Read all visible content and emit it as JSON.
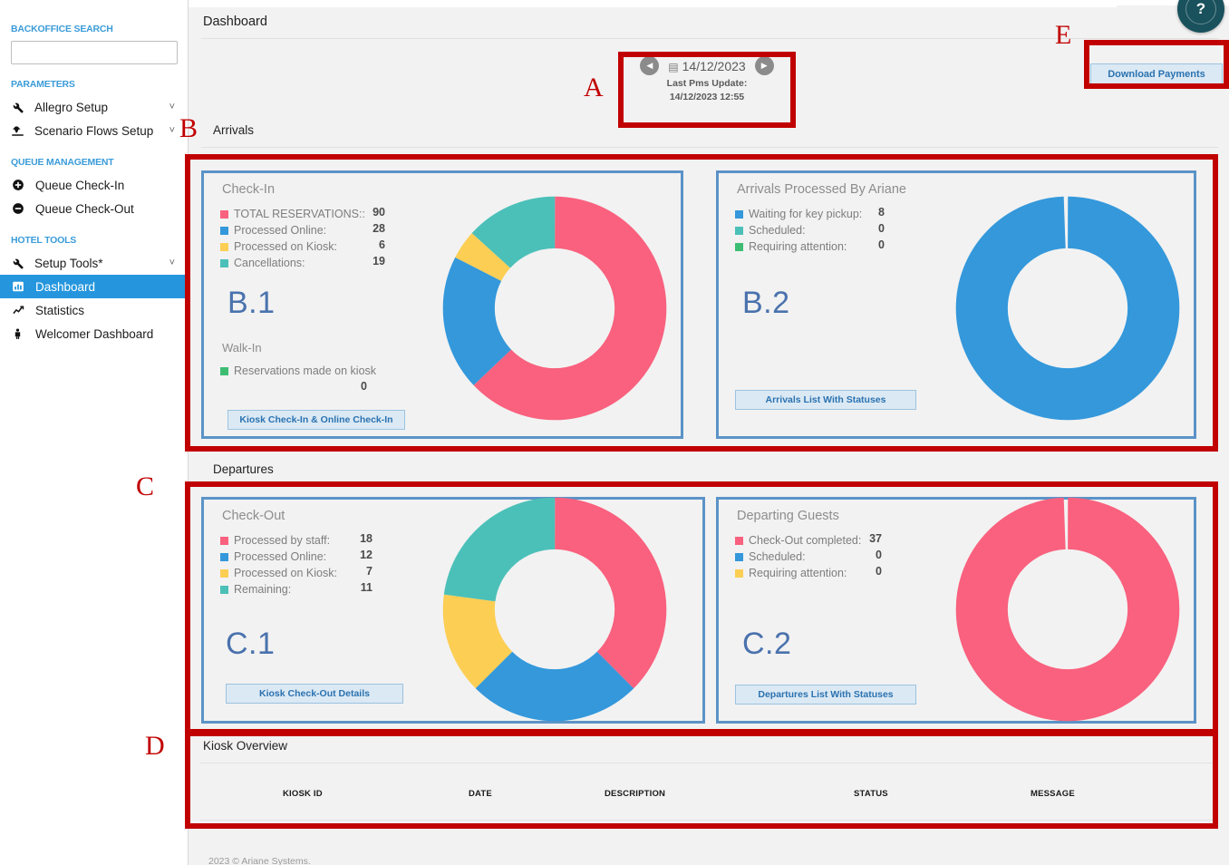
{
  "sidebar": {
    "search": {
      "label": "BACKOFFICE SEARCH",
      "value": "",
      "placeholder": ""
    },
    "groups": [
      {
        "title": "PARAMETERS",
        "items": [
          {
            "label": "Allegro Setup",
            "icon": "wrench-icon",
            "caret": "˅"
          },
          {
            "label": "Scenario Flows Setup",
            "icon": "flow-icon",
            "caret": "˅"
          }
        ]
      },
      {
        "title": "QUEUE MANAGEMENT",
        "items": [
          {
            "label": "Queue Check-In",
            "icon": "plus-circle-icon",
            "caret": ""
          },
          {
            "label": "Queue Check-Out",
            "icon": "minus-circle-icon",
            "caret": ""
          }
        ]
      },
      {
        "title": "HOTEL TOOLS",
        "items": [
          {
            "label": "Setup Tools*",
            "icon": "wrench-icon",
            "caret": "˅"
          },
          {
            "label": "Dashboard",
            "icon": "dashboard-icon",
            "caret": "",
            "active": true
          },
          {
            "label": "Statistics",
            "icon": "trend-up-icon",
            "caret": ""
          },
          {
            "label": "Welcomer Dashboard",
            "icon": "person-icon",
            "caret": ""
          }
        ]
      }
    ]
  },
  "header": {
    "title": "Dashboard",
    "help_label": "?",
    "download_payments_label": "Download Payments"
  },
  "date_nav": {
    "prev_icon": "◀",
    "next_icon": "▶",
    "calendar_icon": "🗓",
    "date": "14/12/2023",
    "pms_label": "Last Pms Update:",
    "pms_value": "14/12/2023 12:55"
  },
  "sections": {
    "arrivals_label": "Arrivals",
    "departures_label": "Departures"
  },
  "cards": {
    "checkin": {
      "title": "Check-In",
      "letter": "B.1",
      "legend": [
        {
          "label": "TOTAL RESERVATIONS::",
          "value": "90",
          "color": "#f9617e"
        },
        {
          "label": "Processed Online:",
          "value": "28",
          "color": "#3498db"
        },
        {
          "label": "Processed on Kiosk:",
          "value": "6",
          "color": "#fcce54"
        },
        {
          "label": "Cancellations:",
          "value": "19",
          "color": "#4bc0b8"
        }
      ],
      "walkin_title": "Walk-In",
      "walkin_label": "Reservations made on kiosk",
      "walkin_color": "#3ebd72",
      "walkin_value": "0",
      "button_label": "Kiosk Check-In & Online Check-In"
    },
    "arrivals_ariane": {
      "title": "Arrivals Processed By Ariane",
      "letter": "B.2",
      "legend": [
        {
          "label": "Waiting for key pickup:",
          "value": "8",
          "color": "#3498db"
        },
        {
          "label": "Scheduled:",
          "value": "0",
          "color": "#4bc0b8"
        },
        {
          "label": "Requiring attention:",
          "value": "0",
          "color": "#3ebd72"
        }
      ],
      "button_label": "Arrivals List With Statuses"
    },
    "checkout": {
      "title": "Check-Out",
      "letter": "C.1",
      "legend": [
        {
          "label": "Processed by staff:",
          "value": "18",
          "color": "#f9617e"
        },
        {
          "label": "Processed Online:",
          "value": "12",
          "color": "#3498db"
        },
        {
          "label": "Processed on Kiosk:",
          "value": "7",
          "color": "#fcce54"
        },
        {
          "label": "Remaining:",
          "value": "11",
          "color": "#4bc0b8"
        }
      ],
      "button_label": "Kiosk Check-Out Details"
    },
    "departing_guests": {
      "title": "Departing Guests",
      "letter": "C.2",
      "legend": [
        {
          "label": "Check-Out completed:",
          "value": "37",
          "color": "#f9617e"
        },
        {
          "label": "Scheduled:",
          "value": "0",
          "color": "#3498db"
        },
        {
          "label": "Requiring attention:",
          "value": "0",
          "color": "#fcce54"
        }
      ],
      "button_label": "Departures List With Statuses"
    }
  },
  "kiosk_overview": {
    "title": "Kiosk Overview",
    "columns": [
      "KIOSK ID",
      "DATE",
      "DESCRIPTION",
      "STATUS",
      "MESSAGE"
    ],
    "rows": []
  },
  "footer": {
    "text": "2023 © Ariane Systems."
  },
  "annotations": [
    {
      "letter": "A"
    },
    {
      "letter": "B"
    },
    {
      "letter": "C"
    },
    {
      "letter": "D"
    },
    {
      "letter": "E"
    }
  ],
  "chart_data": [
    {
      "type": "pie",
      "title": "Check-In",
      "labels": [
        "TOTAL RESERVATIONS::",
        "Processed Online:",
        "Processed on Kiosk:",
        "Cancellations:"
      ],
      "values": [
        90,
        28,
        6,
        19
      ],
      "colors": [
        "#f9617e",
        "#3498db",
        "#fcce54",
        "#4bc0b8"
      ],
      "donut": true,
      "legend_position": "left"
    },
    {
      "type": "pie",
      "title": "Arrivals Processed By Ariane",
      "labels": [
        "Waiting for key pickup:",
        "Scheduled:",
        "Requiring attention:"
      ],
      "values": [
        8,
        0,
        0
      ],
      "colors": [
        "#3498db",
        "#4bc0b8",
        "#3ebd72"
      ],
      "donut": true,
      "legend_position": "left"
    },
    {
      "type": "pie",
      "title": "Check-Out",
      "labels": [
        "Processed by staff:",
        "Processed Online:",
        "Processed on Kiosk:",
        "Remaining:"
      ],
      "values": [
        18,
        12,
        7,
        11
      ],
      "colors": [
        "#f9617e",
        "#3498db",
        "#fcce54",
        "#4bc0b8"
      ],
      "donut": true,
      "legend_position": "left"
    },
    {
      "type": "pie",
      "title": "Departing Guests",
      "labels": [
        "Check-Out completed:",
        "Scheduled:",
        "Requiring attention:"
      ],
      "values": [
        37,
        0,
        0
      ],
      "colors": [
        "#f9617e",
        "#3498db",
        "#fcce54"
      ],
      "donut": true,
      "legend_position": "left"
    }
  ]
}
